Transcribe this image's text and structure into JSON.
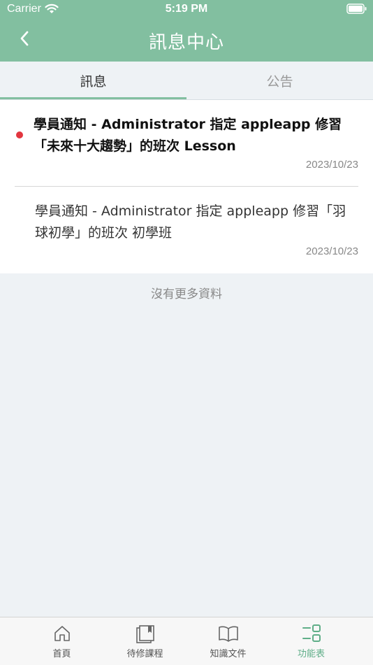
{
  "status_bar": {
    "carrier": "Carrier",
    "time": "5:19 PM"
  },
  "header": {
    "title": "訊息中心",
    "back_icon": "chevron-left-icon"
  },
  "tabs": [
    {
      "label": "訊息",
      "active": true
    },
    {
      "label": "公告",
      "active": false
    }
  ],
  "messages": [
    {
      "text": "學員通知 - Administrator 指定 appleapp 修習「未來十大趨勢」的班次 Lesson",
      "date": "2023/10/23",
      "unread": true
    },
    {
      "text": "學員通知 - Administrator 指定 appleapp 修習「羽球初學」的班次 初學班",
      "date": "2023/10/23",
      "unread": false
    }
  ],
  "no_more_text": "沒有更多資料",
  "tabbar": [
    {
      "label": "首頁",
      "icon": "home-icon",
      "active": false
    },
    {
      "label": "待修課程",
      "icon": "course-icon",
      "active": false
    },
    {
      "label": "知識文件",
      "icon": "book-icon",
      "active": false
    },
    {
      "label": "功能表",
      "icon": "menu-icon",
      "active": true
    }
  ],
  "colors": {
    "accent": "#82bfa0",
    "unread_dot": "#e2363f",
    "active_tab_label": "#5fae88"
  }
}
